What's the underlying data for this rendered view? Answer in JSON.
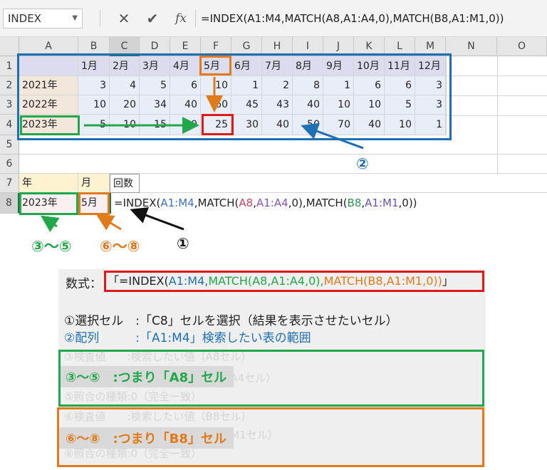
{
  "formula_bar": {
    "name_box": "INDEX",
    "cancel_icon": "✕",
    "enter_icon": "✔",
    "fx_label": "fx",
    "formula": "=INDEX(A1:M4,MATCH(A8,A1:A4,0),MATCH(B8,A1:M1,0))"
  },
  "columns": [
    "A",
    "B",
    "C",
    "D",
    "E",
    "F",
    "G",
    "H",
    "I",
    "J",
    "K",
    "L",
    "M",
    "N",
    "O"
  ],
  "rows": [
    "1",
    "2",
    "3",
    "4",
    "5",
    "6",
    "7",
    "8"
  ],
  "table": {
    "months": [
      "1月",
      "2月",
      "3月",
      "4月",
      "5月",
      "6月",
      "7月",
      "8月",
      "9月",
      "10月",
      "11月",
      "12月"
    ],
    "years": [
      "2021年",
      "2022年",
      "2023年"
    ],
    "values": [
      [
        "3",
        "4",
        "5",
        "6",
        "10",
        "1",
        "2",
        "8",
        "1",
        "6",
        "6",
        "3"
      ],
      [
        "10",
        "20",
        "34",
        "40",
        "60",
        "45",
        "43",
        "40",
        "10",
        "10",
        "5",
        "3"
      ],
      [
        "5",
        "10",
        "15",
        "20",
        "25",
        "30",
        "40",
        "50",
        "70",
        "40",
        "10",
        "1"
      ]
    ]
  },
  "lookup": {
    "year_header": "年",
    "month_header": "月",
    "count_header": "回数",
    "year_value": "2023年",
    "month_value": "5月",
    "formula_in_cell": "=INDEX(A1:M4,MATCH(A8,A1:A4,0),MATCH(B8,A1:M1,0))"
  },
  "annotations": {
    "label_1": "①",
    "label_2": "②",
    "label_3_5": "③～⑤",
    "label_6_8": "⑥～⑧"
  },
  "panel": {
    "eq_label": "数式：",
    "eq_open": "「",
    "eq_close": "」",
    "eq_index": "=INDEX(",
    "eq_range": "A1:M4,",
    "eq_match1": "MATCH(A8,A1:A4,0),",
    "eq_match2": "MATCH(B8,A1:M1,0))",
    "line1": "①選択セル　:「C8」セルを選択（結果を表示させたいセル）",
    "line2": "②配列　　　:「A1:M4」検索したい表の範囲",
    "faint3": "③検査値　　:検索したい値（A8セル）",
    "faint4": "④検査範囲　:検査する範囲（A1～A4セル）",
    "faint5": "⑤照合の種類:0（完全一致）",
    "faint6": "⑥検査値　　:検索したい値（B8セル）",
    "faint7": "⑦検査範囲　:検査する範囲（A1～M1セル）",
    "faint8": "⑧照合の種類:0（完全一致）",
    "summary_3_5": "③～⑤　:つまり「A8」セル",
    "summary_6_8": "⑥～⑧　:つまり「B8」セル"
  },
  "colors": {
    "blue": "#1f6fb5",
    "green": "#22a84a",
    "orange": "#e07a1a",
    "red": "#e01a1a"
  }
}
